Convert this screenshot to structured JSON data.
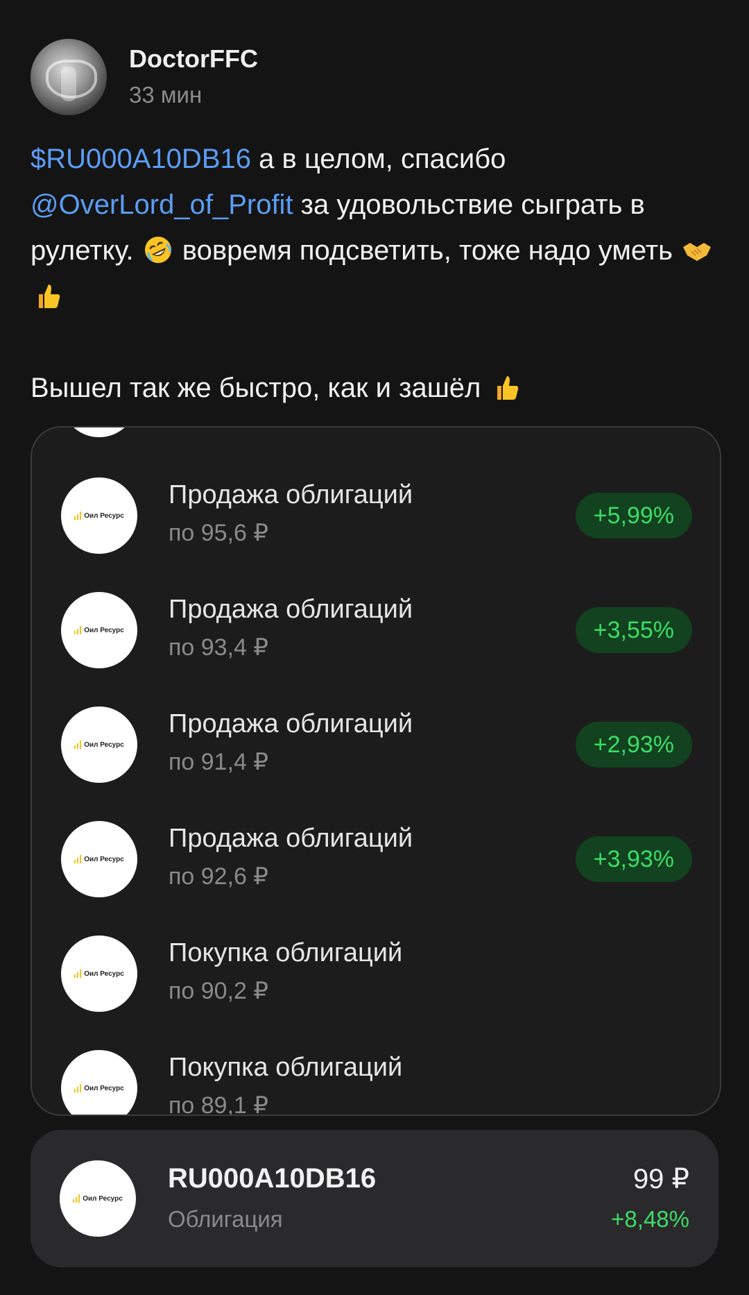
{
  "post": {
    "author": "DoctorFFC",
    "time": "33 мин",
    "ticker_link": "$RU000A10DB16",
    "text_1": " а в  целом, спасибо ",
    "mention_link": "@OverLord_of_Profit",
    "text_2": " за удовольствие сыграть в рулетку. ",
    "text_3": " вовремя подсветить, тоже надо уметь ",
    "text_4": "Вышел так же быстро, как и зашёл "
  },
  "screenshot": {
    "logo_text": "Оил Ресурс",
    "rows": [
      {
        "title": "Продажа облигаций",
        "sub": "по 95,6 ₽",
        "badge": "+5,99%"
      },
      {
        "title": "Продажа облигаций",
        "sub": "по 93,4 ₽",
        "badge": "+3,55%"
      },
      {
        "title": "Продажа облигаций",
        "sub": "по 91,4 ₽",
        "badge": "+2,93%"
      },
      {
        "title": "Продажа облигаций",
        "sub": "по 92,6 ₽",
        "badge": "+3,93%"
      },
      {
        "title": "Покупка облигаций",
        "sub": "по 90,2 ₽",
        "badge": ""
      },
      {
        "title": "Покупка облигаций",
        "sub": "по 89,1 ₽",
        "badge": ""
      }
    ]
  },
  "instrument": {
    "logo_text": "Оил Ресурс",
    "ticker": "RU000A10DB16",
    "type": "Облигация",
    "price": "99 ₽",
    "change": "+8,48%"
  },
  "colors": {
    "background": "#141414",
    "link": "#5b9df5",
    "positive": "#3ddc67",
    "badge_bg": "#12421f"
  },
  "icons": [
    "rolling-on-floor-laughing-emoji",
    "handshake-emoji",
    "thumbs-up-emoji",
    "oil-resource-logo"
  ]
}
